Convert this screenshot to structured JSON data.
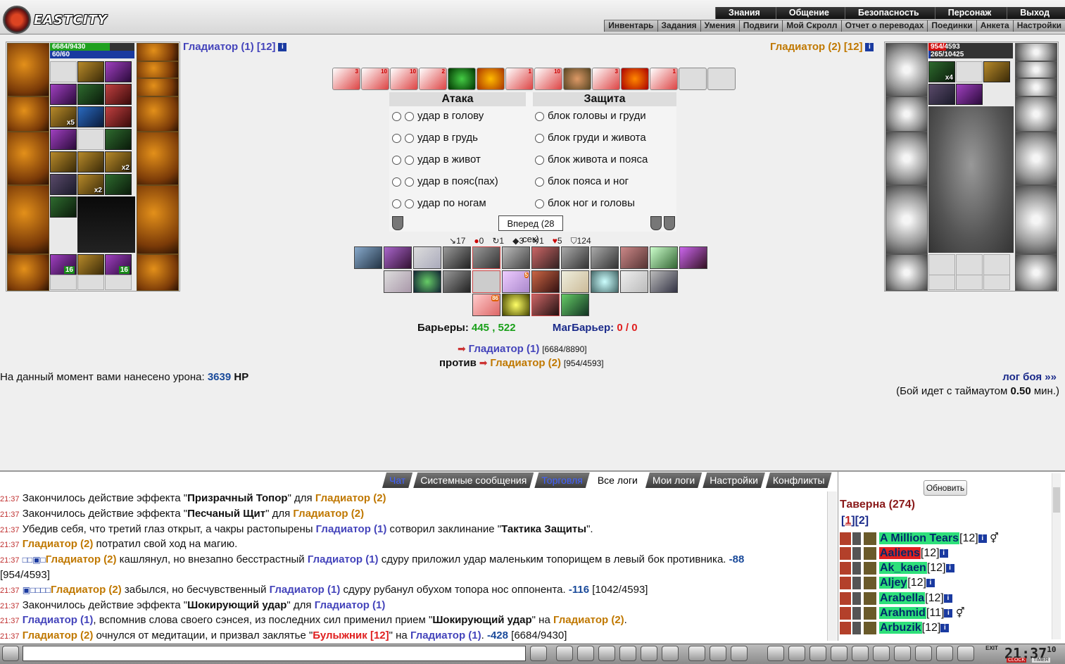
{
  "topbar": {
    "logo": "EASTCITY",
    "menu_primary": [
      "Знания",
      "Общение",
      "Безопасность",
      "Персонаж",
      "Выход"
    ],
    "menu_secondary": [
      "Инвентарь",
      "Задания",
      "Умения",
      "Подвиги",
      "Мой Скролл",
      "Отчет о переводах",
      "Поединки",
      "Анкета",
      "Настройки"
    ]
  },
  "player1": {
    "name": "Гладиатор (1) [12]",
    "hp": "6684/9430",
    "mana": "60/60",
    "hp_fraction": 0.709,
    "mana_fraction": 1.0,
    "item_counts": [
      "x5",
      "x2",
      "x2",
      "16",
      "16"
    ]
  },
  "player2": {
    "name": "Гладиатор (2) [12]",
    "hp": "954/4593",
    "mana": "265/10425",
    "hp_fraction": 0.208,
    "mana_fraction": 0.025,
    "item_counts": [
      "x4"
    ]
  },
  "effects_counts": [
    "3",
    "10",
    "10",
    "2",
    "",
    "",
    "1",
    "10",
    "",
    "3",
    "",
    "1"
  ],
  "battle": {
    "attack_header": "Атака",
    "defense_header": "Защита",
    "attacks": [
      "удар в голову",
      "удар в грудь",
      "удар в живот",
      "удар в пояс(пах)",
      "удар по ногам"
    ],
    "blocks": [
      "блок головы и груди",
      "блок груди и живота",
      "блок живота и пояса",
      "блок пояса и ног",
      "блок ног и головы"
    ],
    "forward_button": "Вперед (28 сек)",
    "stats": [
      "17",
      "0",
      "1",
      "3",
      "1",
      "5",
      "124"
    ],
    "skill_badges": [
      "5",
      "86"
    ],
    "barriers_label": "Барьеры:",
    "barriers_value": "445 , 522",
    "magbarrier_label": "МагБарьер:",
    "magbarrier_value": "0 / 0",
    "p1_line_name": "Гладиатор (1)",
    "p1_line_hp": "[6684/8890]",
    "versus": "против",
    "p2_line_name": "Гладиатор (2)",
    "p2_line_hp": "[954/4593]",
    "damage_label": "На данный момент вами нанесено урона:",
    "damage_value": "3639",
    "damage_unit": "HP",
    "log_link": "лог боя »»",
    "timeout_prefix": "(Бой идет с таймаутом",
    "timeout_value": "0.50",
    "timeout_suffix": "мин.)"
  },
  "chat": {
    "tabs": [
      "Чат",
      "Системные сообщения",
      "Торговля",
      "Все логи",
      "Мои логи",
      "Настройки",
      "Конфликты"
    ],
    "active_tab": "Все логи",
    "time": "21:37",
    "log_bits": {
      "l1a": "Закончилось действие эффекта \"",
      "l1b": "Призрачный Топор",
      "l1c": "\" для ",
      "l1d": "Гладиатор (2)",
      "l2a": "Закончилось действие эффекта \"",
      "l2b": "Песчаный Щит",
      "l2c": "\" для ",
      "l2d": "Гладиатор (2)",
      "l3a": "Убедив себя, что третий глаз открыт, а чакры растопырены ",
      "l3b": "Гладиатор (1)",
      "l3c": " сотворил заклинание \"",
      "l3d": "Тактика Защиты",
      "l3e": "\".",
      "l4a": "Гладиатор (2)",
      "l4b": " потратил свой ход на магию.",
      "l5pre": "□□▣□",
      "l5a": "Гладиатор (2)",
      "l5b": " кашлянул, но внезапно бесстрастный ",
      "l5c": "Гладиатор (1)",
      "l5d": " сдуру приложил удар маленьким топорищем в левый бок противника. ",
      "l5e": "-88",
      "l5f": "[954/4593]",
      "l6pre": "▣□□□□",
      "l6a": "Гладиатор (2)",
      "l6b": " забылся, но бесчувственный ",
      "l6c": "Гладиатор (1)",
      "l6d": " сдуру рубанул обухом топора нос оппонента. ",
      "l6e": "-116",
      "l6f": " [1042/4593]",
      "l7a": "Закончилось действие эффекта \"",
      "l7b": "Шокирующий удар",
      "l7c": "\" для ",
      "l7d": "Гладиатор (1)",
      "l8a": "Гладиатор (1)",
      "l8b": ", вспомнив слова своего сэнсея, из последних сил применил прием \"",
      "l8c": "Шокирующий удар",
      "l8d": "\" на ",
      "l8e": "Гладиатор (2)",
      "l8f": ".",
      "l9a": "Гладиатор (2)",
      "l9b": " очнулся от медитации, и призвал заклятье \"",
      "l9c": "Булыжник [12]",
      "l9d": "\" на ",
      "l9e": "Гладиатор (1)",
      "l9f": ". ",
      "l9g": "-428",
      "l9h": " [6684/9430]"
    }
  },
  "sidebar": {
    "refresh_button": "Обновить",
    "room_title": "Таверна (274)",
    "pages": [
      "1",
      "2"
    ],
    "users": [
      {
        "name": "A Million Tears",
        "level": "[12]"
      },
      {
        "name": "Aaliens",
        "level": "[12]"
      },
      {
        "name": "Ak_kaen",
        "level": "[12]"
      },
      {
        "name": "Aljey",
        "level": "[12]"
      },
      {
        "name": "Arabella",
        "level": "[12]"
      },
      {
        "name": "Arahmid",
        "level": "[11]"
      },
      {
        "name": "Arbuzik",
        "level": "[12]"
      }
    ]
  },
  "bottom": {
    "clock": "21:37",
    "clock_small": "10",
    "clock_label": "CLOCK",
    "timer_label": "TIMER",
    "exit_label": "EXIT"
  },
  "colors": {
    "player1": "#4444bb",
    "player2": "#c07800",
    "hp_bar": "#1fa01f",
    "mana_bar": "#1a3aa0",
    "enemy_hp_bar": "#d01010",
    "barriers_green": "#1aa01a",
    "magbarrier_red": "#e02020"
  }
}
